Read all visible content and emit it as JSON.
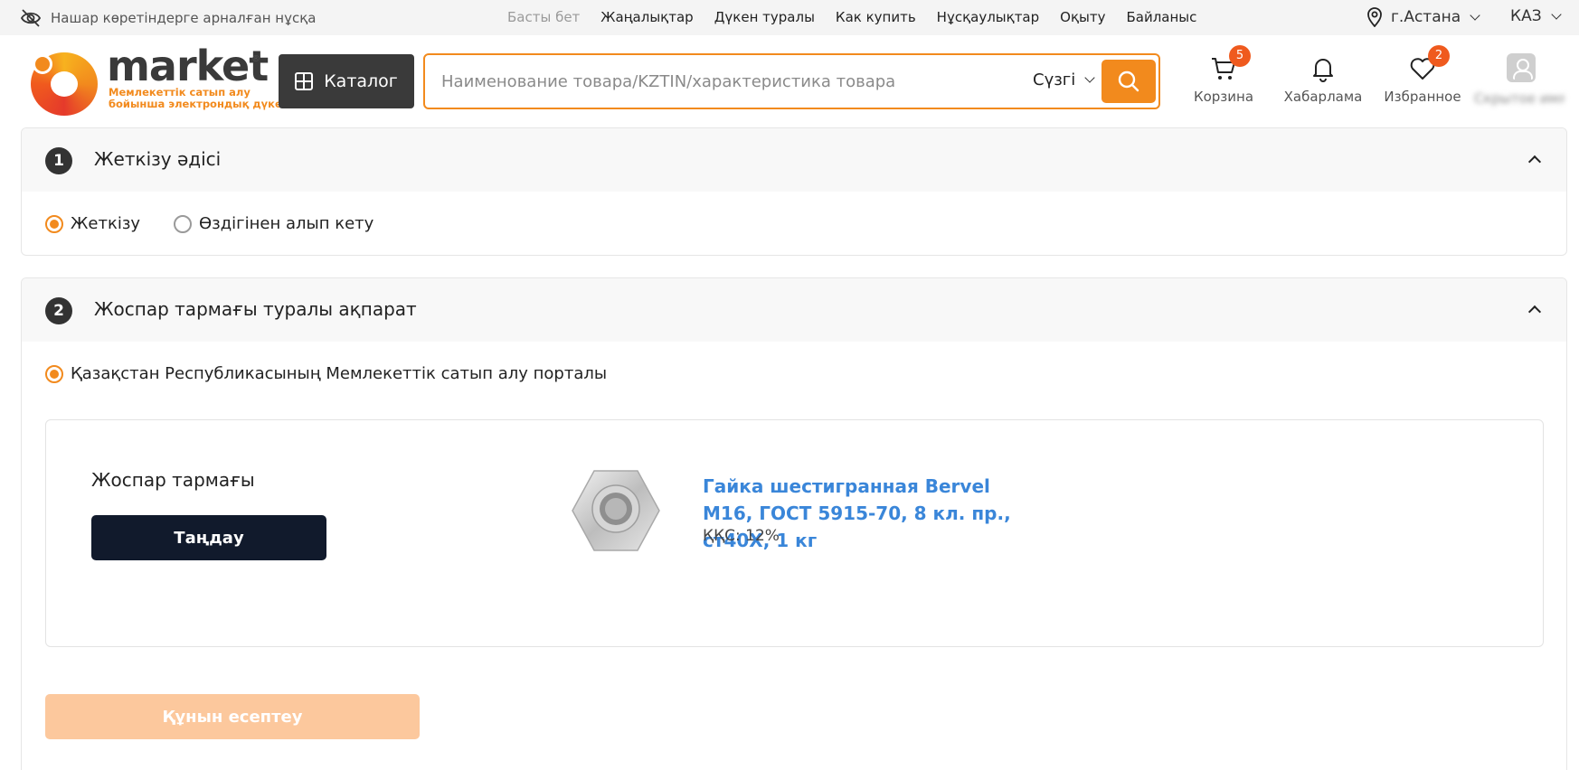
{
  "topbar": {
    "low_vision": "Нашар көретіндерге арналған нұсқа",
    "nav": [
      "Басты бет",
      "Жаңалықтар",
      "Дүкен туралы",
      "Как купить",
      "Нұсқаулықтар",
      "Оқыту",
      "Байланыс"
    ],
    "city": "г.Астана",
    "language": "КАЗ"
  },
  "logo": {
    "word": "market",
    "reg": "®",
    "subtitle_line1": "Мемлекеттік сатып алу",
    "subtitle_line2": "бойынша электрондық дүкен"
  },
  "header": {
    "catalog_label": "Каталог",
    "search_placeholder": "Наименование товара/KZTIN/характеристика товара",
    "filter_label": "Сүзгі",
    "cart_label": "Корзина",
    "cart_count": "5",
    "notifications_label": "Хабарлама",
    "favorites_label": "Избранное",
    "favorites_count": "2",
    "user_name": "Скрытое имя"
  },
  "delivery": {
    "step": "1",
    "title": "Жеткізу әдісі",
    "options": [
      "Жеткізу",
      "Өздігінен алып кету"
    ],
    "selected": "Жеткізу"
  },
  "plan": {
    "step": "2",
    "title": "Жоспар тармағы туралы ақпарат",
    "portal_option": "Қазақстан Республикасының Мемлекеттік сатып алу порталы",
    "plan_item_label": "Жоспар тармағы",
    "choose_button": "Таңдау",
    "product_name": "Гайка шестигранная Bervel M16, ГОСТ 5915-70, 8 кл. пр., ст40Х, 1 кг",
    "product_vat": "ҚҚС: 12%",
    "calculate_button": "Құнын есептеу"
  },
  "colors": {
    "accent": "#f28a1d",
    "dark_button": "#111a2c",
    "link": "#3a86d9",
    "disabled_button": "#fcc89d",
    "badge": "#ef5a1e"
  }
}
